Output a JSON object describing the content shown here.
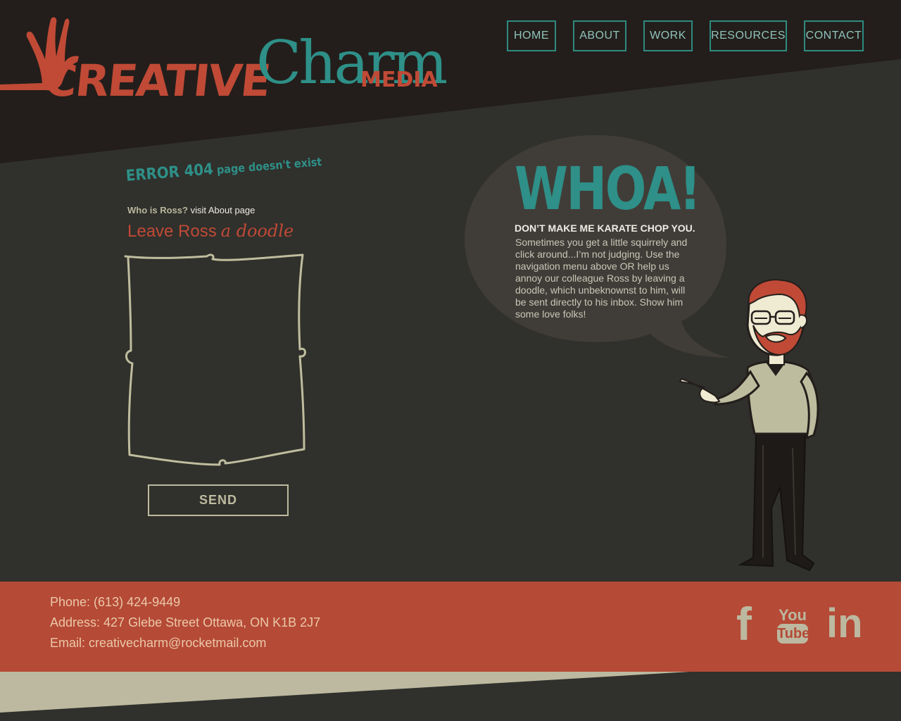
{
  "logo": {
    "creative": "CREATIVE",
    "charm": "Charm",
    "media": "MEDIA"
  },
  "nav": [
    {
      "label": "HOME"
    },
    {
      "label": "ABOUT"
    },
    {
      "label": "WORK"
    },
    {
      "label": "RESOURCES"
    },
    {
      "label": "CONTACT"
    }
  ],
  "error": {
    "code": "ERROR 404",
    "message": "page doesn't exist"
  },
  "who": {
    "question": "Who is Ross?",
    "link": "visit About page"
  },
  "doodle": {
    "leave": "Leave Ross",
    "script": "a doodle",
    "send_label": "SEND"
  },
  "bubble": {
    "headline": "WHOA!",
    "subhead": "DON’T MAKE ME KARATE CHOP YOU.",
    "body": "Sometimes you get a little squirrely and click around...I’m not judging. Use the navigation menu above OR help us annoy our colleague Ross by leaving a doodle, which unbeknownst to him, will be sent  directly to his inbox. Show him some love folks!"
  },
  "footer": {
    "phone": "Phone: (613) 424-9449",
    "address": "Address: 427 Glebe Street Ottawa, ON K1B 2J7",
    "email": "Email: creativecharm@rocketmail.com",
    "social": {
      "youtube_top": "You",
      "youtube_bottom": "Tube",
      "linkedin": "in",
      "facebook": "f"
    }
  },
  "colors": {
    "background": "#30302c",
    "header": "#231e1b",
    "accent_red": "#c04a36",
    "accent_teal": "#2e9088",
    "cream": "#bcb9a0",
    "footer": "#b54a36"
  }
}
